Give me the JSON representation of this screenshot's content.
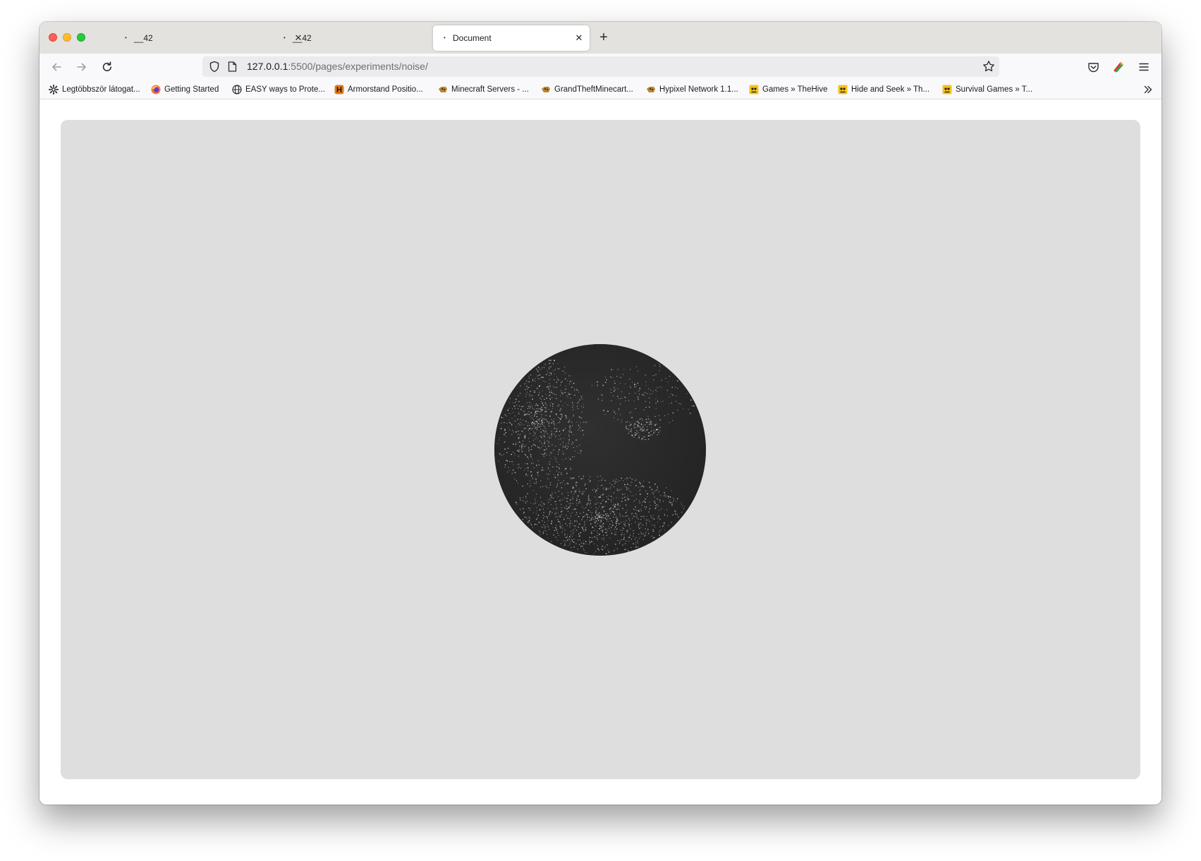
{
  "window": {
    "tabs": [
      {
        "title": "__42",
        "active": false
      },
      {
        "title": "__42",
        "active": false
      },
      {
        "title": "Document",
        "active": true
      }
    ]
  },
  "toolbar": {
    "url_host": "127.0.0.1",
    "url_rest": ":5500/pages/experiments/noise/"
  },
  "bookmarks": [
    {
      "label": "Legtöbbször látogat...",
      "icon": "gear-icon"
    },
    {
      "label": "Getting Started",
      "icon": "firefox-icon"
    },
    {
      "label": "EASY ways to Prote...",
      "icon": "globe-icon"
    },
    {
      "label": "Armorstand Positio...",
      "icon": "armorstand-favicon"
    },
    {
      "label": "Minecraft Servers - ...",
      "icon": "minecraft-favicon"
    },
    {
      "label": "GrandTheftMinecart...",
      "icon": "minecraft-favicon"
    },
    {
      "label": "Hypixel Network 1.1...",
      "icon": "minecraft-favicon"
    },
    {
      "label": "Games » TheHive",
      "icon": "hive-favicon"
    },
    {
      "label": "Hide and Seek » Th...",
      "icon": "hive-favicon"
    },
    {
      "label": "Survival Games » T...",
      "icon": "hive-favicon"
    }
  ],
  "colors": {
    "stage_background": "#dedede",
    "orb_color": "#2a2a2a",
    "speckle_color": "#d8d8d8"
  }
}
